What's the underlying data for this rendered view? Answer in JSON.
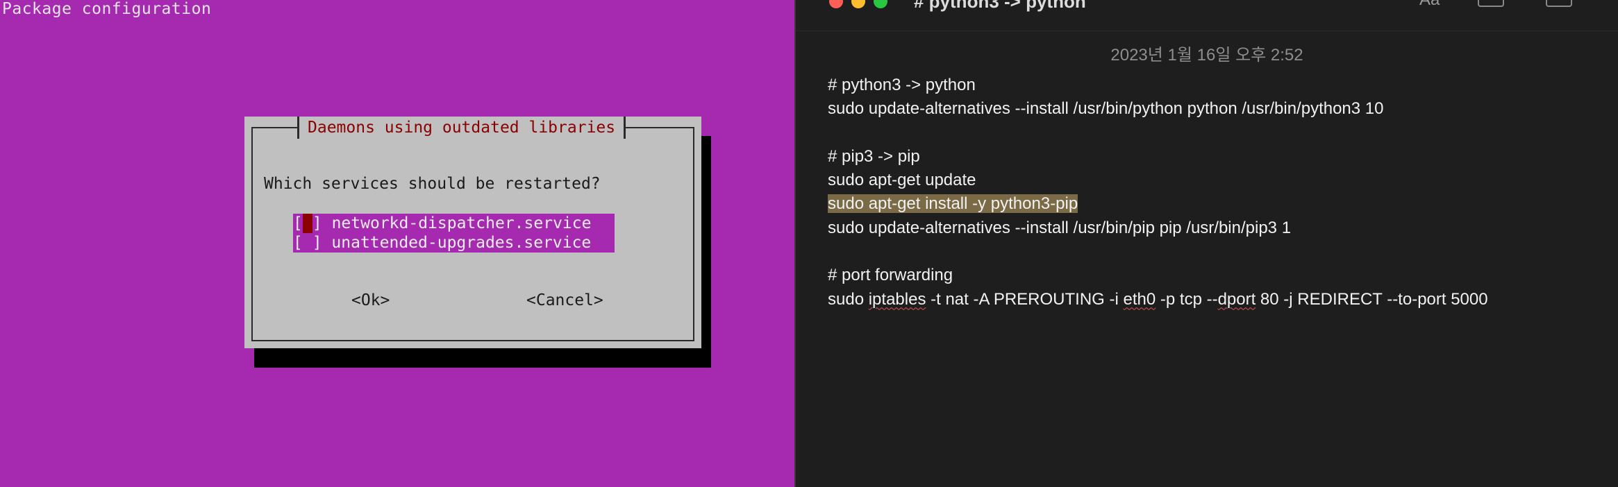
{
  "terminal": {
    "title": "Package configuration",
    "dialog": {
      "title": "Daemons using outdated libraries",
      "question": "Which services should be restarted?",
      "services": [
        {
          "checkbox": "[ ]",
          "label": "networkd-dispatcher.service",
          "checked": false,
          "focused": true
        },
        {
          "checkbox": "[ ]",
          "label": "unattended-upgrades.service",
          "checked": false,
          "focused": false
        }
      ],
      "ok_label": "<Ok>",
      "cancel_label": "<Cancel>"
    },
    "colors": {
      "background": "#a52ab0",
      "dialog": "#c0c0c0",
      "title_text": "#8b0000",
      "shadow": "#000000"
    }
  },
  "notes": {
    "window_title": "# python3 -> python",
    "toolbar": {
      "font_label": "Aa"
    },
    "timestamp": "2023년 1월 16일 오후 2:52",
    "lines": {
      "l1": "# python3 -> python",
      "l2": "sudo update-alternatives --install /usr/bin/python python /usr/bin/python3 10",
      "l4": "# pip3 -> pip",
      "l5": "sudo apt-get update",
      "l6": "sudo apt-get install -y python3-pip",
      "l7": "sudo update-alternatives --install /usr/bin/pip pip /usr/bin/pip3 1",
      "l9": "# port forwarding",
      "l10": {
        "p1": "sudo ",
        "p2": "iptables",
        "p3": " -t nat -A PREROUTING -i ",
        "p4": "eth0",
        "p5": " -p tcp --",
        "p6": "dport",
        "p7": " 80 -j REDIRECT --to-port 5000"
      }
    },
    "colors": {
      "background": "#1e1e1e",
      "text": "#f2f2f2",
      "highlight": "#7a6a45",
      "timestamp": "#8e8e8e"
    }
  }
}
